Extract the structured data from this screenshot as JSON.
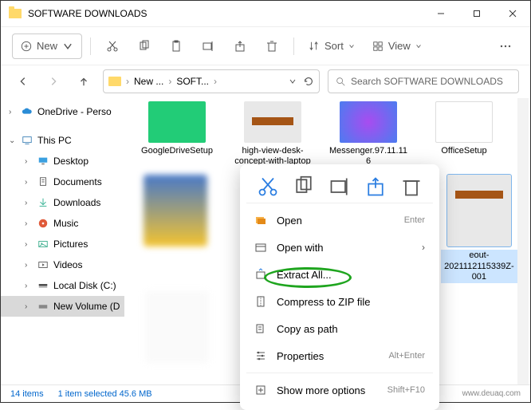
{
  "window": {
    "title": "SOFTWARE DOWNLOADS"
  },
  "toolbar": {
    "new": "New",
    "sort": "Sort",
    "view": "View"
  },
  "address": {
    "crumb1": "New ...",
    "crumb2": "SOFT...",
    "search_placeholder": "Search SOFTWARE DOWNLOADS"
  },
  "sidebar": {
    "onedrive": "OneDrive - Perso",
    "thispc": "This PC",
    "desktop": "Desktop",
    "documents": "Documents",
    "downloads": "Downloads",
    "music": "Music",
    "pictures": "Pictures",
    "videos": "Videos",
    "localc": "Local Disk (C:)",
    "newvol": "New Volume (D"
  },
  "files": {
    "f1": "GoogleDriveSetup",
    "f2": "high-view-desk-concept-with-laptop",
    "f3": "Messenger.97.11.116",
    "f4": "OfficeSetup",
    "f5": "eout-2021112115339Z-001"
  },
  "ctx": {
    "open": "Open",
    "open_hint": "Enter",
    "openwith": "Open with",
    "extract": "Extract All...",
    "compress": "Compress to ZIP file",
    "copypath": "Copy as path",
    "properties": "Properties",
    "properties_hint": "Alt+Enter",
    "more": "Show more options",
    "more_hint": "Shift+F10"
  },
  "status": {
    "count": "14 items",
    "sel": "1 item selected  45.6 MB"
  },
  "watermark": "www.deuaq.com"
}
